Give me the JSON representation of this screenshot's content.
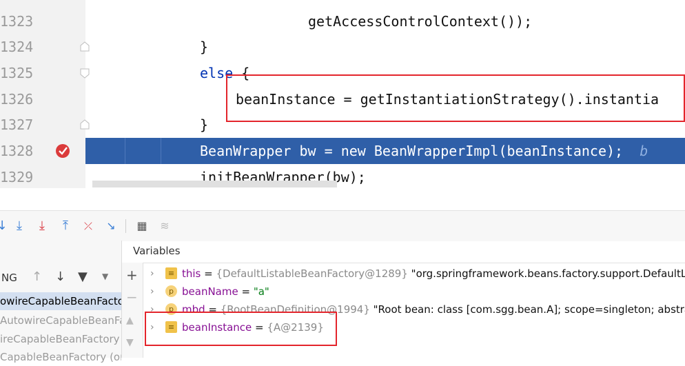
{
  "editor": {
    "lines": [
      {
        "num": "1323",
        "code": "getAccessControlContext());"
      },
      {
        "num": "1324",
        "code": "}"
      },
      {
        "num": "1325",
        "keyword": "else",
        "code": " {"
      },
      {
        "num": "1326",
        "code": "beanInstance = getInstantiationStrategy().instantia"
      },
      {
        "num": "1327",
        "code": "}"
      },
      {
        "num": "1328",
        "code": "BeanWrapper bw = new BeanWrapperImpl(beanInstance);",
        "tail": "b"
      },
      {
        "num": "1329",
        "code": "initBeanWrapper(bw);"
      }
    ],
    "breakpoint_line": "1328"
  },
  "toolbar": {
    "icons": [
      "step-over-icon",
      "step-into-icon",
      "force-step-into-icon",
      "step-out-icon",
      "drop-frame-icon",
      "run-to-cursor-icon",
      "evaluate-icon",
      "trace-icon"
    ]
  },
  "frames": {
    "thread_label": "NG",
    "items": [
      {
        "label": "owireCapableBeanFactor",
        "selected": true
      },
      {
        "label": "AutowireCapableBeanFa",
        "selected": false
      },
      {
        "label": "ireCapableBeanFactory (",
        "selected": false
      },
      {
        "label": "CapableBeanFactory (org",
        "selected": false
      }
    ]
  },
  "variables": {
    "title": "Variables",
    "rows": [
      {
        "name": "this",
        "eq": " = ",
        "ref": "{DefaultListableBeanFactory@1289}",
        "value": " \"org.springframework.beans.factory.support.DefaultListab",
        "icon": "field"
      },
      {
        "name": "beanName",
        "eq": " = ",
        "ref": "",
        "value": "\"a\"",
        "icon": "p"
      },
      {
        "name": "mbd",
        "eq": " = ",
        "ref": "{RootBeanDefinition@1994}",
        "value": " \"Root bean: class [com.sgg.bean.A]; scope=singleton; abstract=f",
        "icon": "p"
      },
      {
        "name": "beanInstance",
        "eq": " = ",
        "ref": "{A@2139}",
        "value": "",
        "icon": "field"
      }
    ]
  },
  "colors": {
    "highlight": "#2f5fa8",
    "annotation_box": "#e3242b",
    "keyword": "#0033b3"
  }
}
